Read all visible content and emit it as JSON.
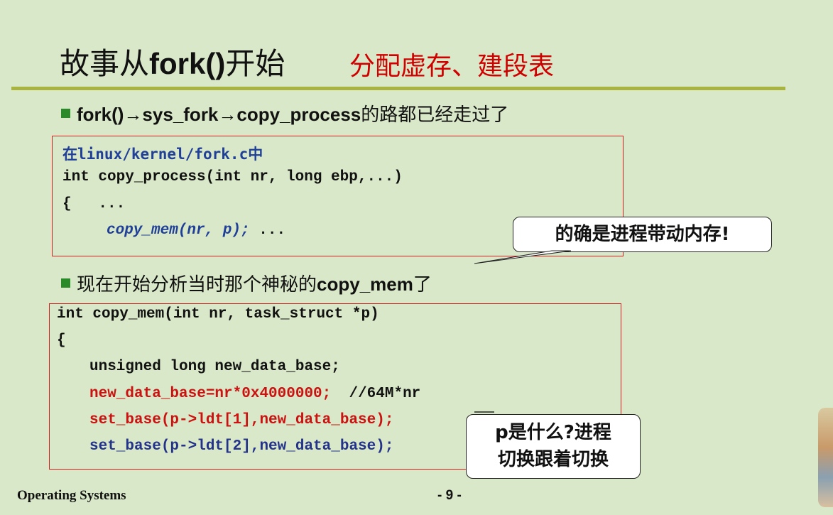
{
  "slide": {
    "title_prefix": "故事从",
    "title_bold": "fork()",
    "title_suffix": "开始",
    "subtitle": "分配虚存、建段表",
    "bullet1": "fork()→sys_fork→copy_process",
    "bullet1_suffix": "的路都已经走过了",
    "bullet2_prefix": "现在开始分析当时那个神秘的",
    "bullet2_bold": "copy_mem",
    "bullet2_suffix": "了",
    "footer_left": "Operating Systems",
    "footer_page": "- 9 -"
  },
  "code1": {
    "line1": "在linux/kernel/fork.c中",
    "line2": "int copy_process(int nr, long ebp,...)",
    "line3": "{   ...",
    "line4_code": "copy_mem(nr, p);",
    "line4_rest": " ..."
  },
  "code2": {
    "line1": "int copy_mem(int nr, task_struct *p)",
    "line2": "{",
    "line3": "unsigned long new_data_base;",
    "line4_code": "new_data_base=nr*0x4000000;",
    "line4_comment": "  //64M*nr",
    "line5": "set_base(p->ldt[1],new_data_base);",
    "line6": "set_base(p->ldt[2],new_data_base);"
  },
  "callouts": {
    "callout1": "的确是进程带动内存!",
    "callout2_line1": "p是什么?进程",
    "callout2_line2": "切换跟着切换"
  },
  "colors": {
    "background": "#d9e8c8",
    "accent_red": "#cc1111",
    "rule": "#a9b340",
    "code_blue": "#1f3f99"
  }
}
